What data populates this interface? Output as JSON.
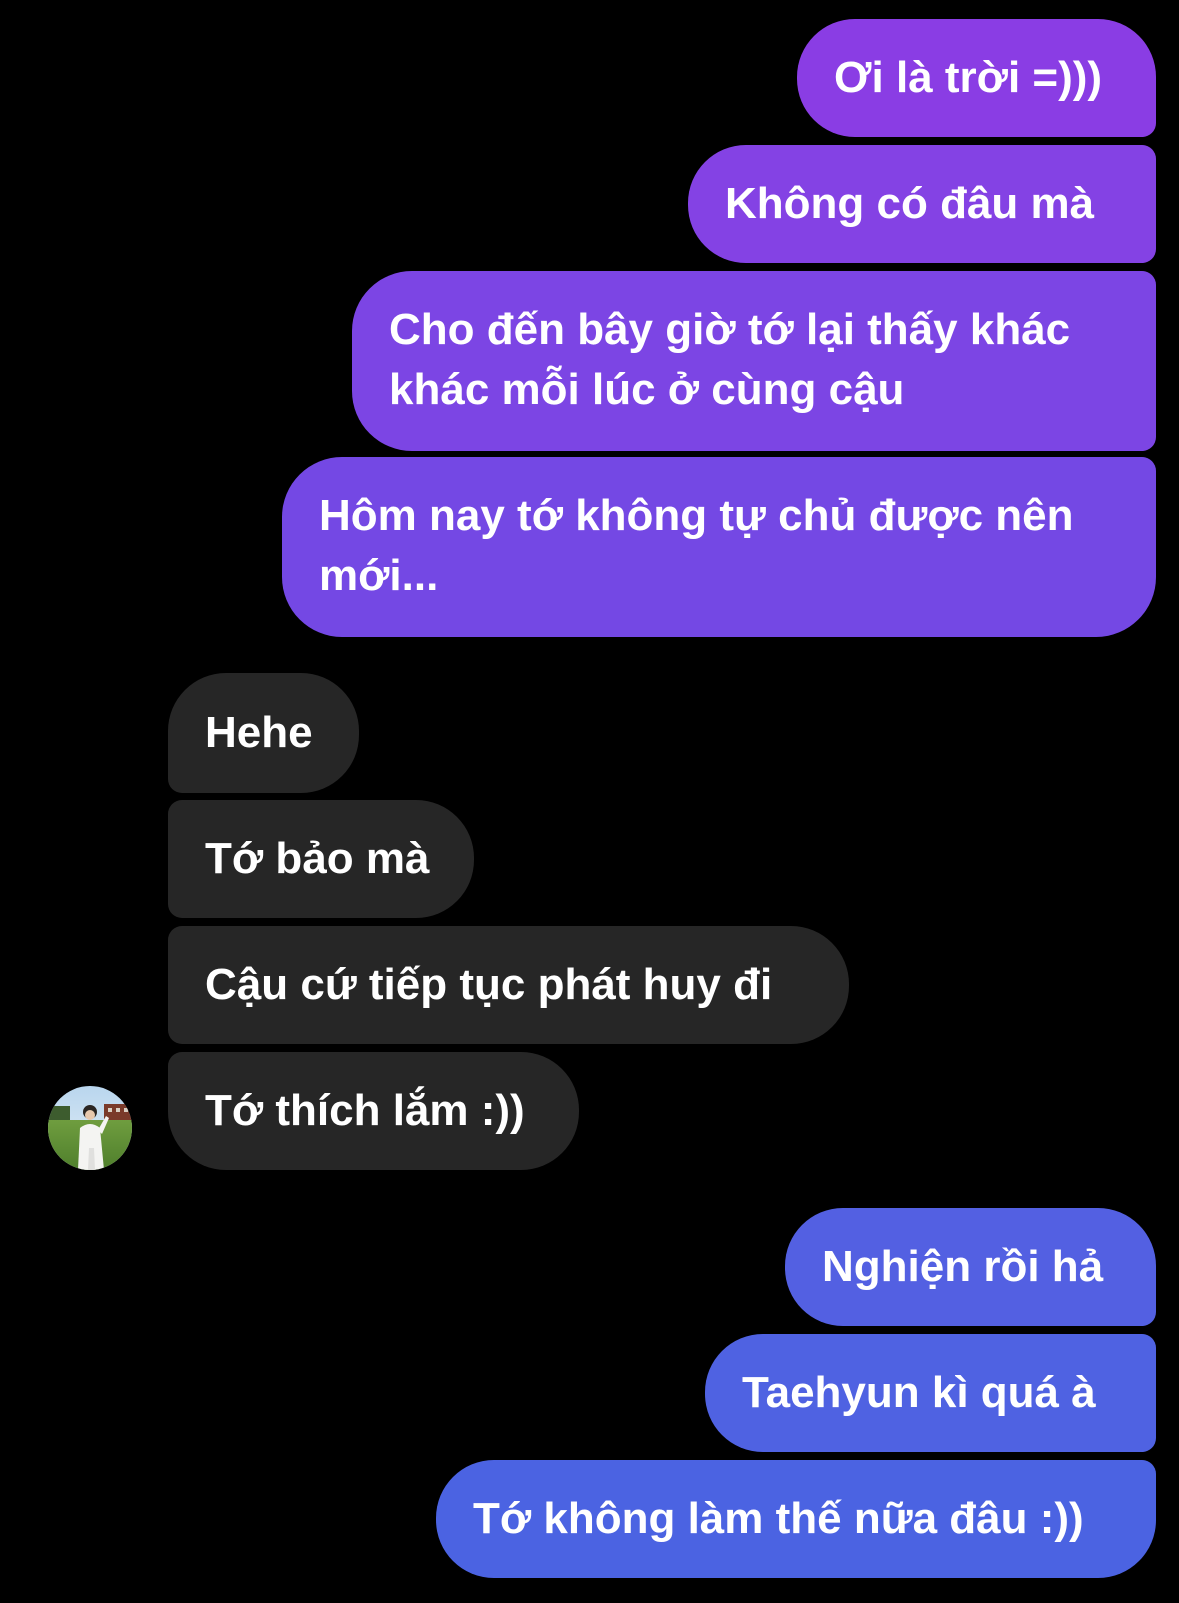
{
  "conversation": {
    "outgoing_group_1": [
      {
        "text": "Ơi là trời =)))"
      },
      {
        "text": "Không có đâu mà"
      },
      {
        "text": "Cho đến bây giờ tớ lại thấy khác khác mỗi lúc ở cùng cậu",
        "line1": "Cho đến bây giờ tớ lại thấy khác",
        "line2": "khác mỗi lúc ở cùng cậu"
      },
      {
        "text": "Hôm nay tớ không tự chủ được nên mới...",
        "line1": "Hôm nay tớ không tự chủ được nên",
        "line2": "mới..."
      }
    ],
    "incoming_group": [
      {
        "text": "Hehe"
      },
      {
        "text": "Tớ bảo mà"
      },
      {
        "text": "Cậu cứ tiếp tục phát huy đi"
      },
      {
        "text": "Tớ thích lắm :))"
      }
    ],
    "outgoing_group_2": [
      {
        "text": "Nghiện rồi hả"
      },
      {
        "text": "Taehyun kì quá à"
      },
      {
        "text": "Tớ không làm thế nữa đâu :))"
      }
    ]
  },
  "contact": {
    "avatar_icon": "contact-avatar-photo"
  },
  "colors": {
    "background": "#000000",
    "incoming_bubble": "#262626",
    "outgoing_top": "#8a3de4",
    "outgoing_mid": "#7447e4",
    "outgoing_bottom": "#4b63e2",
    "text": "#ffffff"
  }
}
